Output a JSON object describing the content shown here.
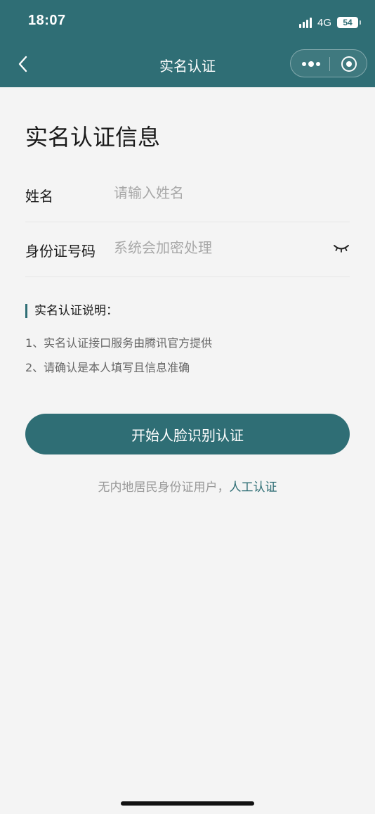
{
  "status_bar": {
    "time": "18:07",
    "network": "4G",
    "battery": "54"
  },
  "nav": {
    "title": "实名认证"
  },
  "page": {
    "title": "实名认证信息"
  },
  "form": {
    "name": {
      "label": "姓名",
      "placeholder": "请输入姓名",
      "value": ""
    },
    "id_number": {
      "label": "身份证号码",
      "placeholder": "系统会加密处理",
      "value": ""
    }
  },
  "notes": {
    "title": "实名认证说明：",
    "items": [
      "1、实名认证接口服务由腾讯官方提供",
      "2、请确认是本人填写且信息准确"
    ]
  },
  "actions": {
    "start_label": "开始人脸识别认证"
  },
  "footer": {
    "text": "无内地居民身份证用户，",
    "link_label": "人工认证"
  },
  "colors": {
    "brand": "#2f6e75",
    "background": "#f4f4f4",
    "placeholder": "#a8a8a8"
  }
}
